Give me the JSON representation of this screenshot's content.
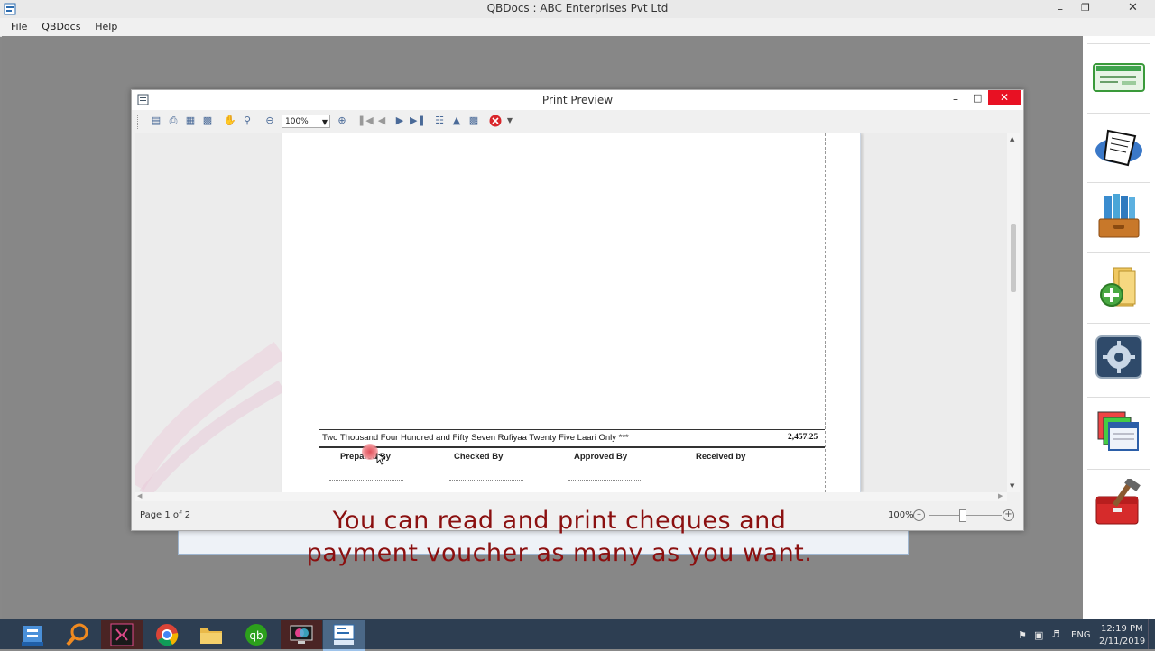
{
  "app": {
    "title": "QBDocs : ABC Enterprises Pvt Ltd",
    "menu": [
      "File",
      "QBDocs",
      "Help"
    ]
  },
  "print_preview": {
    "title": "Print Preview",
    "zoom_value": "100%",
    "amount_words": "Two Thousand Four Hundred and Fifty Seven Rufiyaa Twenty Five Laari Only ***",
    "amount": "2,457.25",
    "signatures": [
      "Prepared By",
      "Checked By",
      "Approved By",
      "Received by"
    ],
    "status_page": "Page 1 of 2",
    "status_zoom": "100%"
  },
  "caption": {
    "line1": "You can read and print cheques and",
    "line2": "payment voucher as many as you want."
  },
  "sidebar_icons": [
    "cheque-icon",
    "receipt-printer-icon",
    "file-binders-icon",
    "add-folder-icon",
    "settings-gear-icon",
    "windows-stack-icon",
    "toolbox-icon"
  ],
  "taskbar": {
    "apps": [
      "file-explorer-icon",
      "search-icon",
      "media-app-icon",
      "chrome-icon",
      "folder-icon",
      "quickbooks-icon",
      "monitor-app-icon",
      "qbdocs-icon"
    ],
    "lang": "ENG",
    "time": "12:19 PM",
    "date": "2/11/2019"
  },
  "colors": {
    "caption": "#8b1010",
    "close_button": "#e81123",
    "taskbar": "#2d3e52"
  }
}
